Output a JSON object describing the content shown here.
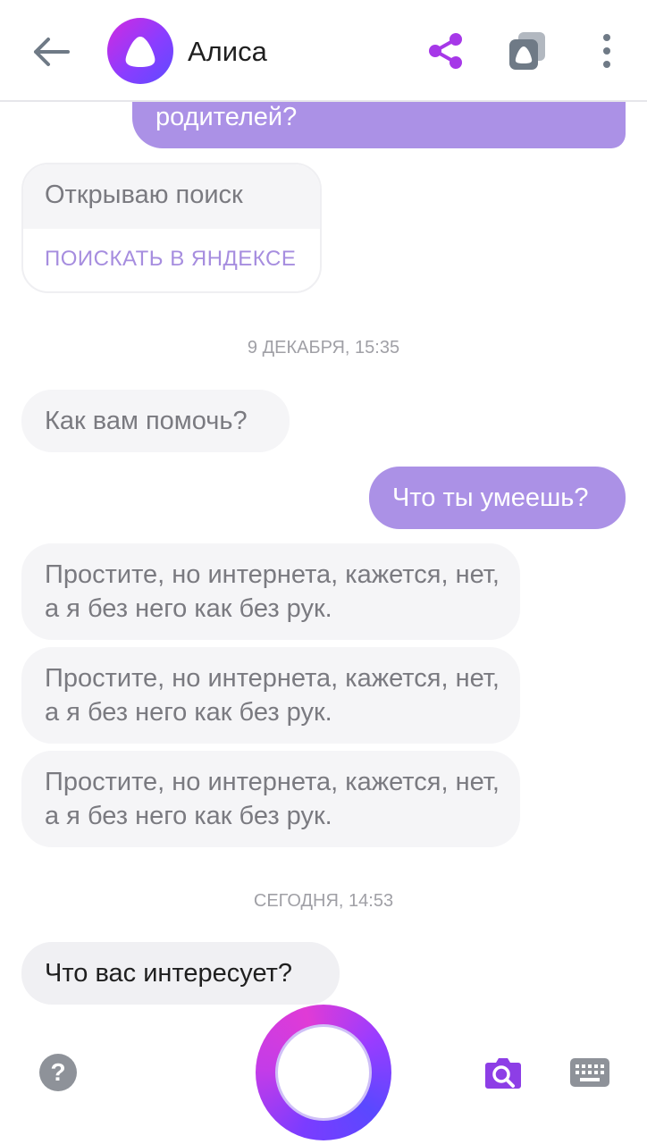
{
  "header": {
    "title": "Алиса"
  },
  "messages": {
    "top_user": "родителей?",
    "search_card": {
      "text": "Открываю поиск",
      "button": "ПОИСКАТЬ В ЯНДЕКСЕ"
    },
    "date1": "9 ДЕКАБРЯ, 15:35",
    "help": "Как вам помочь?",
    "user_question": "Что ты умеешь?",
    "errors": [
      "Простите, но интернета, кажется, нет, а я без него как без рук.",
      "Простите, но интернета, кажется, нет, а я без него как без рук.",
      "Простите, но интернета, кажется, нет, а я без него как без рук."
    ],
    "date2": "СЕГОДНЯ, 14:53",
    "interest": "Что вас интересует?"
  },
  "bottom": {
    "help_symbol": "?"
  },
  "colors": {
    "accent_purple": "#8a3dff",
    "user_bubble": "#ab91e6",
    "alice_bubble": "#f5f5f7",
    "link": "#a68ddf"
  }
}
